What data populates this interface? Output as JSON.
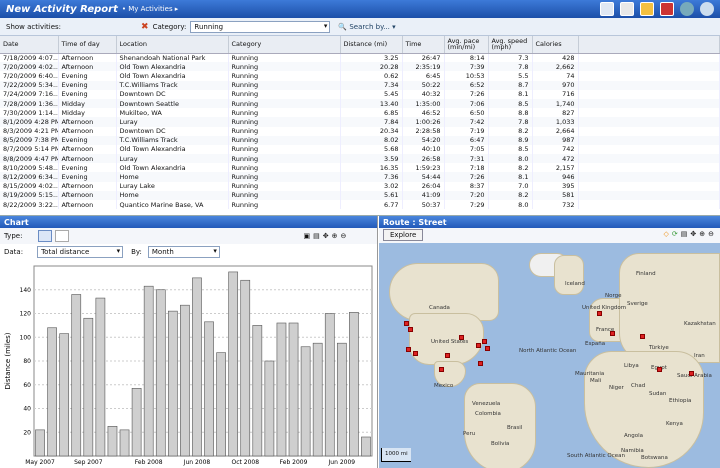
{
  "title": {
    "main": "New Activity Report",
    "breadcrumb": "• My Activities ▸"
  },
  "filter": {
    "show_label": "Show activities:",
    "category_label": "Category:",
    "category_value": "Running",
    "search_label": "Search by..."
  },
  "table": {
    "headers": [
      "Date",
      "Time of day",
      "Location",
      "Category",
      "Distance (mi)",
      "Time",
      "Avg. pace (min/mi)",
      "Avg. speed (mph)",
      "Calories"
    ],
    "rows": [
      [
        "7/18/2009 4:07...",
        "Afternoon",
        "Shenandoah National Park",
        "Running",
        "3.25",
        "26:47",
        "8:14",
        "7.3",
        "428"
      ],
      [
        "7/20/2009 4:02...",
        "Afternoon",
        "Old Town Alexandria",
        "Running",
        "20.28",
        "2:35:19",
        "7:39",
        "7.8",
        "2,662"
      ],
      [
        "7/20/2009 6:40...",
        "Evening",
        "Old Town Alexandria",
        "Running",
        "0.62",
        "6:45",
        "10:53",
        "5.5",
        "74"
      ],
      [
        "7/22/2009 5:34...",
        "Evening",
        "T.C.Williams Track",
        "Running",
        "7.34",
        "50:22",
        "6:52",
        "8.7",
        "970"
      ],
      [
        "7/24/2009 7:16...",
        "Evening",
        "Downtown DC",
        "Running",
        "5.45",
        "40:32",
        "7:26",
        "8.1",
        "716"
      ],
      [
        "7/28/2009 1:36...",
        "Midday",
        "Downtown Seattle",
        "Running",
        "13.40",
        "1:35:00",
        "7:06",
        "8.5",
        "1,740"
      ],
      [
        "7/30/2009 1:14...",
        "Midday",
        "Mukilteo, WA",
        "Running",
        "6.85",
        "46:52",
        "6:50",
        "8.8",
        "827"
      ],
      [
        "8/1/2009 4:28 PM",
        "Afternoon",
        "Luray",
        "Running",
        "7.84",
        "1:00:26",
        "7:42",
        "7.8",
        "1,033"
      ],
      [
        "8/3/2009 4:21 PM",
        "Afternoon",
        "Downtown DC",
        "Running",
        "20.34",
        "2:28:58",
        "7:19",
        "8.2",
        "2,664"
      ],
      [
        "8/5/2009 7:38 PM",
        "Evening",
        "T.C.Williams Track",
        "Running",
        "8.02",
        "54:20",
        "6:47",
        "8.9",
        "987"
      ],
      [
        "8/7/2009 5:14 PM",
        "Afternoon",
        "Old Town Alexandria",
        "Running",
        "5.68",
        "40:10",
        "7:05",
        "8.5",
        "742"
      ],
      [
        "8/8/2009 4:47 PM",
        "Afternoon",
        "Luray",
        "Running",
        "3.59",
        "26:58",
        "7:31",
        "8.0",
        "472"
      ],
      [
        "8/10/2009 5:48...",
        "Evening",
        "Old Town Alexandria",
        "Running",
        "16.35",
        "1:59:23",
        "7:18",
        "8.2",
        "2,157"
      ],
      [
        "8/12/2009 6:34...",
        "Evening",
        "Home",
        "Running",
        "7.36",
        "54:44",
        "7:26",
        "8.1",
        "946"
      ],
      [
        "8/15/2009 4:02...",
        "Afternoon",
        "Luray Lake",
        "Running",
        "3.02",
        "26:04",
        "8:37",
        "7.0",
        "395"
      ],
      [
        "8/19/2009 5:15...",
        "Afternoon",
        "Home",
        "Running",
        "5.61",
        "41:09",
        "7:20",
        "8.2",
        "581"
      ],
      [
        "8/22/2009 3:22...",
        "Afternoon",
        "Quantico Marine Base, VA",
        "Running",
        "6.77",
        "50:37",
        "7:29",
        "8.0",
        "732"
      ]
    ]
  },
  "chart_panel": {
    "title": "Chart",
    "type_label": "Type:",
    "data_label": "Data:",
    "data_value": "Total distance",
    "by_label": "By:",
    "by_value": "Month"
  },
  "chart_data": {
    "type": "bar",
    "ylabel": "Distance (miles)",
    "ylim": [
      0,
      160
    ],
    "yticks": [
      20,
      40,
      60,
      80,
      100,
      120,
      140
    ],
    "xticks": [
      "May 2007",
      "Sep 2007",
      "Feb 2008",
      "Jun 2008",
      "Oct 2008",
      "Feb 2009",
      "Jun 2009"
    ],
    "values": [
      22,
      108,
      103,
      136,
      116,
      133,
      25,
      22,
      57,
      143,
      140,
      122,
      127,
      150,
      113,
      87,
      155,
      148,
      110,
      80,
      112,
      112,
      92,
      95,
      120,
      95,
      121,
      16
    ]
  },
  "map_panel": {
    "title": "Route : Street",
    "explore_label": "Explore",
    "scale": "1000 mi"
  },
  "map_labels": [
    "Canada",
    "United States",
    "Mexico",
    "Brasil",
    "Venezuela",
    "Colombia",
    "Peru",
    "Bolivia",
    "Iceland",
    "Norge",
    "Sverige",
    "Finland",
    "United Kingdom",
    "France",
    "España",
    "Türkiye",
    "Libya",
    "Egypt",
    "Mali",
    "Niger",
    "Chad",
    "Sudan",
    "Ethiopia",
    "Kenya",
    "Angola",
    "Namibia",
    "Botswana",
    "Saudi Arabia",
    "Iran",
    "Kazakhstan",
    "South Atlantic Ocean",
    "North Atlantic Ocean",
    "Mauritania"
  ]
}
